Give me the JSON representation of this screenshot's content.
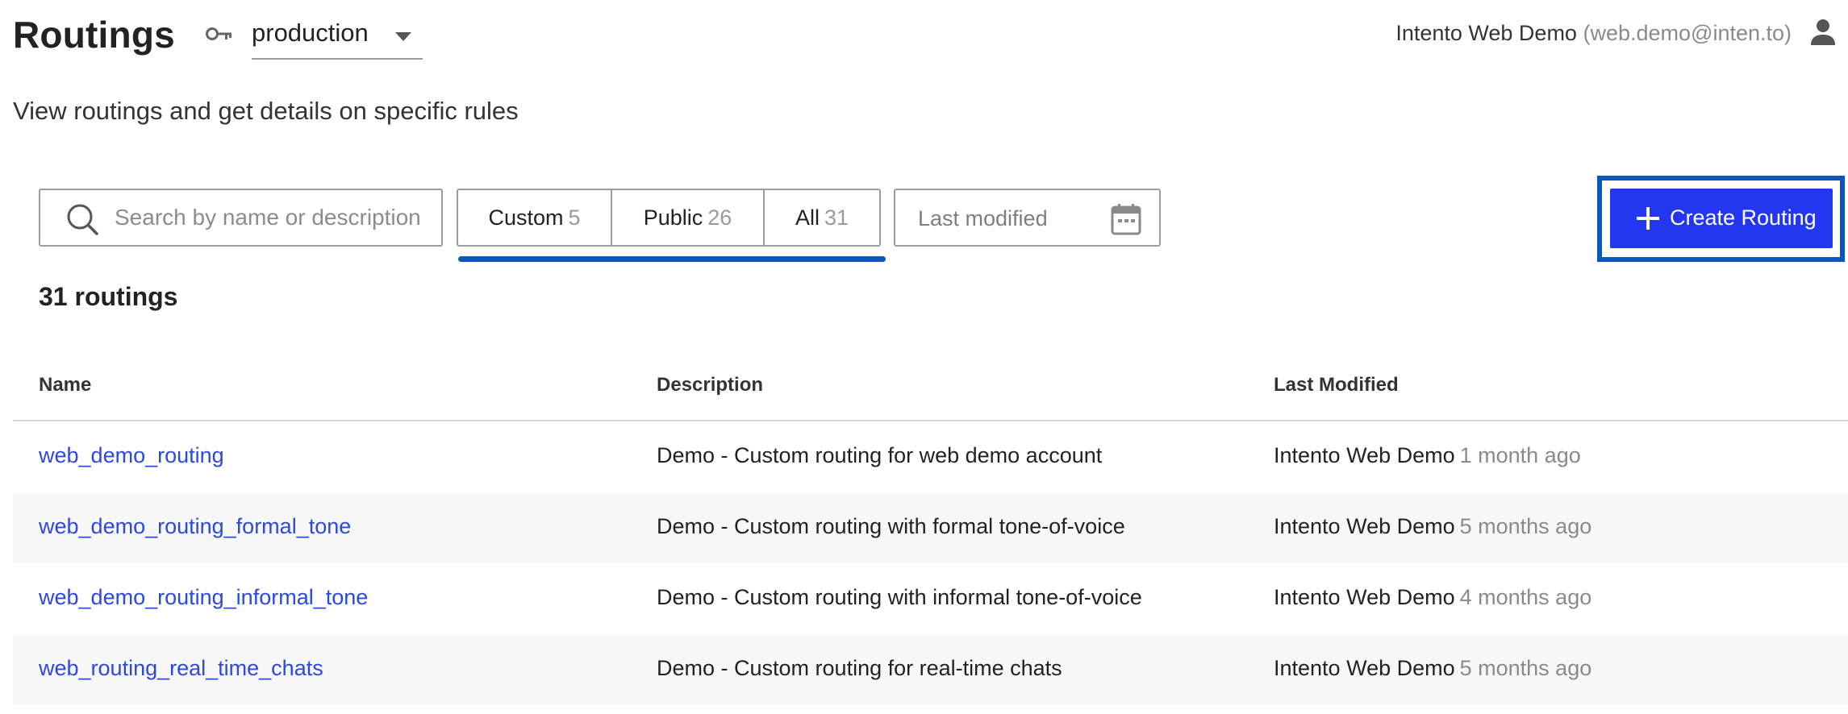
{
  "header": {
    "title": "Routings",
    "environment": "production",
    "account_name": "Intento Web Demo",
    "account_email": "(web.demo@inten.to)"
  },
  "subtitle": "View routings and get details on specific rules",
  "toolbar": {
    "search_placeholder": "Search by name or description",
    "tabs": [
      {
        "label": "Custom",
        "count": "5"
      },
      {
        "label": "Public",
        "count": "26"
      },
      {
        "label": "All",
        "count": "31"
      }
    ],
    "date_filter_label": "Last modified",
    "create_label": "Create Routing"
  },
  "count_heading": "31 routings",
  "table": {
    "columns": [
      "Name",
      "Description",
      "Last Modified"
    ],
    "rows": [
      {
        "name": "web_demo_routing",
        "description": "Demo - Custom routing for web demo account",
        "modified_by": "Intento Web Demo",
        "modified_ago": "1 month ago"
      },
      {
        "name": "web_demo_routing_formal_tone",
        "description": "Demo - Custom routing with formal tone-of-voice",
        "modified_by": "Intento Web Demo",
        "modified_ago": "5 months ago"
      },
      {
        "name": "web_demo_routing_informal_tone",
        "description": "Demo - Custom routing with informal tone-of-voice",
        "modified_by": "Intento Web Demo",
        "modified_ago": "4 months ago"
      },
      {
        "name": "web_routing_real_time_chats",
        "description": "Demo - Custom routing for real-time chats",
        "modified_by": "Intento Web Demo",
        "modified_ago": "5 months ago"
      }
    ]
  },
  "icons": {
    "key": "key-icon",
    "dropdown": "chevron-down-icon",
    "user": "user-icon",
    "search": "search-icon",
    "calendar": "calendar-icon",
    "plus": "plus-icon"
  },
  "colors": {
    "primary_button": "#2336f0",
    "focus_outline": "#0b57b9",
    "link": "#2b49e0",
    "muted_text": "#8a8a8a"
  }
}
